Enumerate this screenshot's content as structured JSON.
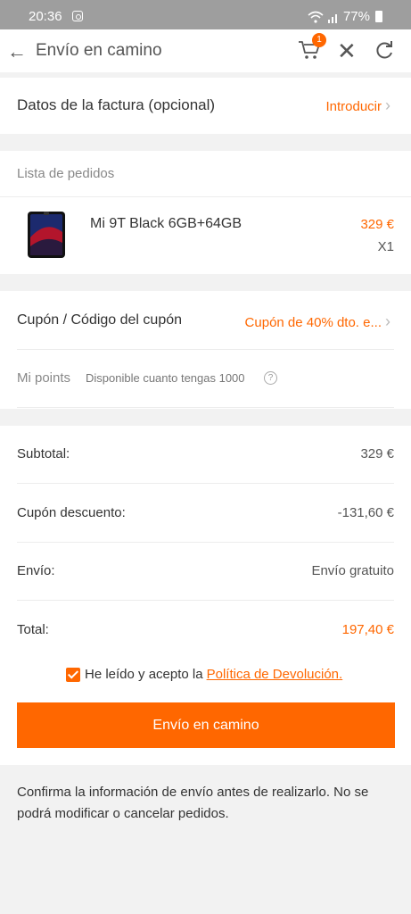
{
  "status_bar": {
    "time": "20:36",
    "battery": "77%"
  },
  "header": {
    "title": "Envío en camino",
    "cart_count": "1"
  },
  "invoice": {
    "label": "Datos de la factura (opcional)",
    "action": "Introducir"
  },
  "orders": {
    "heading": "Lista de pedidos",
    "item": {
      "name": "Mi 9T Black 6GB+64GB",
      "price": "329 €",
      "quantity": "X1"
    }
  },
  "coupon": {
    "label": "Cupón / Código del cupón",
    "value": "Cupón de 40% dto. e...",
    "points_label": "Mi points",
    "points_info": "Disponible cuanto tengas 1000",
    "help": "?"
  },
  "summary": {
    "rows": [
      {
        "label": "Subtotal:",
        "value": "329 €"
      },
      {
        "label": "Cupón descuento:",
        "value": "-131,60 €"
      },
      {
        "label": "Envío:",
        "value": "Envío gratuito"
      },
      {
        "label": "Total:",
        "value": "197,40 €"
      }
    ],
    "agree_text": "He leído y acepto la",
    "policy_link": "Política de Devolución.",
    "submit_label": "Envío en camino"
  },
  "notice": "Confirma la información de envío antes de realizarlo. No se podrá modificar o cancelar pedidos.",
  "colors": {
    "accent": "#ff6700",
    "status_bar": "#9e9e9e",
    "background": "#f2f2f2"
  },
  "icons": [
    "instagram-icon",
    "wifi-icon",
    "signal-icon",
    "battery-icon",
    "back-arrow-icon",
    "cart-icon",
    "close-icon",
    "refresh-icon",
    "chevron-right-icon",
    "help-icon",
    "checkbox-checked-icon"
  ]
}
